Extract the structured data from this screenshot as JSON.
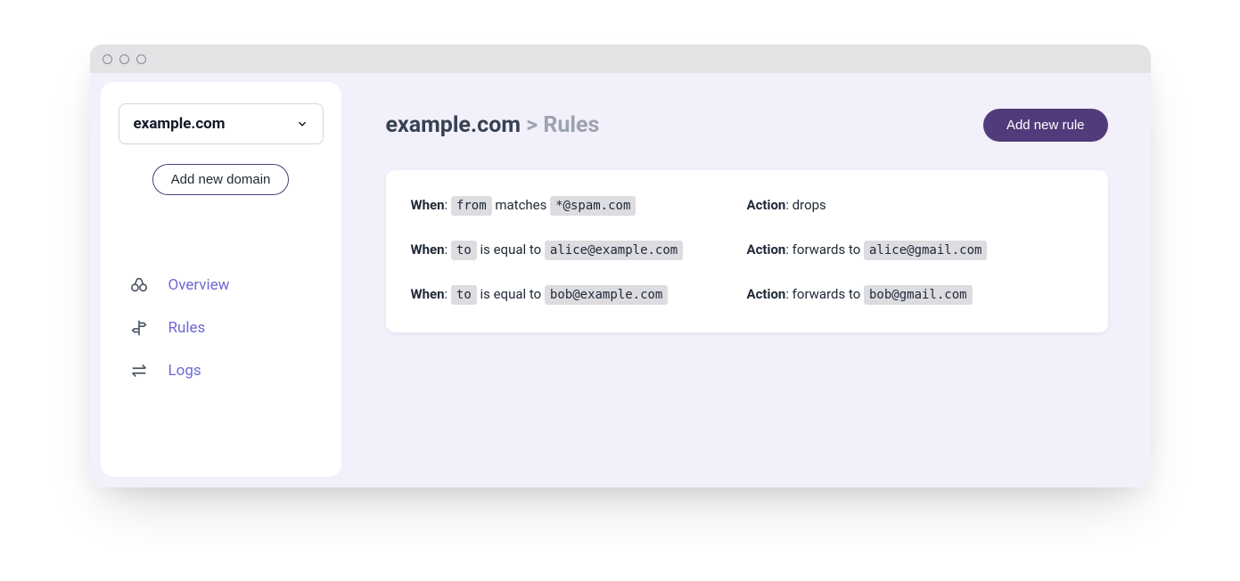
{
  "sidebar": {
    "selected_domain": "example.com",
    "add_domain_label": "Add new domain",
    "nav": [
      {
        "label": "Overview"
      },
      {
        "label": "Rules"
      },
      {
        "label": "Logs"
      }
    ]
  },
  "header": {
    "breadcrumb_domain": "example.com",
    "breadcrumb_sep": " > ",
    "breadcrumb_page": "Rules",
    "add_rule_label": "Add new rule"
  },
  "labels": {
    "when": "When",
    "action": "Action"
  },
  "rules": [
    {
      "field": "from",
      "op": " matches ",
      "value": "*@spam.com",
      "action_text": ": drops",
      "action_target": null
    },
    {
      "field": "to",
      "op": " is equal to ",
      "value": "alice@example.com",
      "action_text": ": forwards to ",
      "action_target": "alice@gmail.com"
    },
    {
      "field": "to",
      "op": " is equal to ",
      "value": "bob@example.com",
      "action_text": ": forwards to ",
      "action_target": "bob@gmail.com"
    }
  ]
}
